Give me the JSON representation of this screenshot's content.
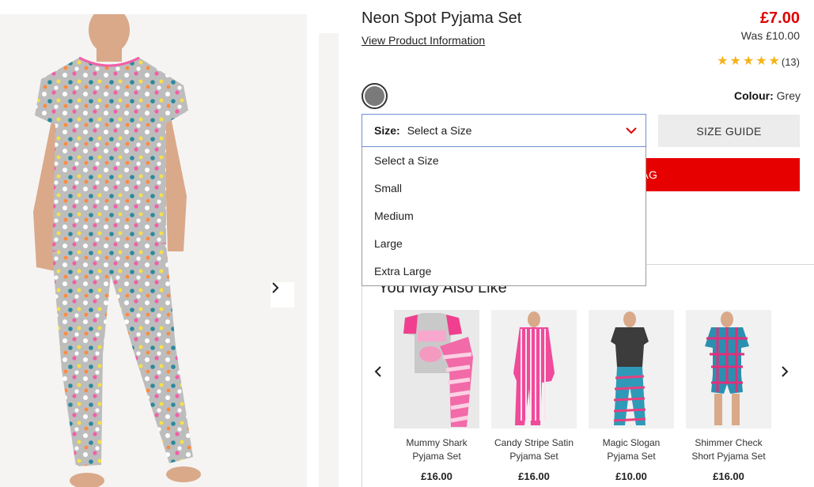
{
  "product": {
    "title": "Neon Spot Pyjama Set",
    "view_info": "View Product Information",
    "price": "£7.00",
    "was_price": "Was £10.00",
    "rating_count": "(13)",
    "rating_stars": 5,
    "colour_label": "Colour:",
    "colour_value": "Grey",
    "swatch_color": "#7a7a7a"
  },
  "size": {
    "label": "Size:",
    "selected": "Select a Size",
    "options": [
      "Select a Size",
      "Small",
      "Medium",
      "Large",
      "Extra Large"
    ]
  },
  "buttons": {
    "size_guide": "SIZE GUIDE",
    "add_to_bag": "TO BAG"
  },
  "icons": {
    "chevron_right": "chevron-right-icon",
    "chevron_left": "chevron-left-icon",
    "chevron_down": "chevron-down-icon",
    "star": "star-icon"
  },
  "colors": {
    "price_red": "#e00000",
    "bag_red": "#e60000",
    "star_gold": "#f6b21b",
    "select_border": "#6d8fd6"
  },
  "recommendations": {
    "title": "You May Also Like",
    "items": [
      {
        "name_line1": "Mummy Shark",
        "name_line2": "Pyjama Set",
        "price": "£16.00"
      },
      {
        "name_line1": "Candy Stripe Satin",
        "name_line2": "Pyjama Set",
        "price": "£16.00"
      },
      {
        "name_line1": "Magic Slogan",
        "name_line2": "Pyjama Set",
        "price": "£10.00"
      },
      {
        "name_line1": "Shimmer Check",
        "name_line2": "Short Pyjama Set",
        "price": "£16.00"
      }
    ]
  }
}
